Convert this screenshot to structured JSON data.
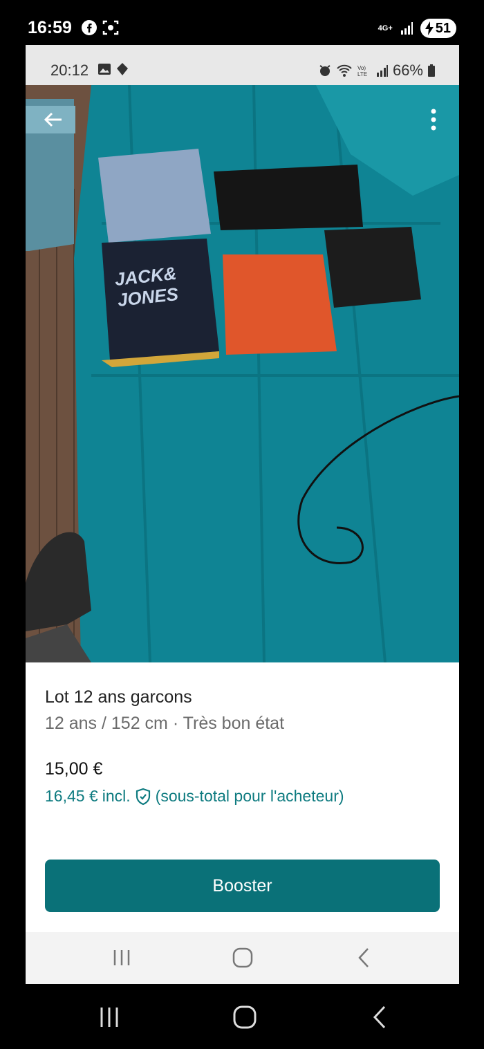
{
  "outer_status": {
    "time": "16:59",
    "network": "4G+",
    "battery": "51",
    "icons": [
      "facebook-icon",
      "screen-record-icon",
      "signal-icon",
      "charging-icon"
    ]
  },
  "inner_status": {
    "time": "20:12",
    "battery_percent": "66%",
    "icons": [
      "gallery-icon",
      "app-notification-icon",
      "alarm-icon",
      "wifi-icon",
      "volte-icon",
      "signal-icon",
      "battery-icon"
    ]
  },
  "photo": {
    "description_label": "JACK& JONES",
    "back_icon": "back-arrow-icon",
    "more_icon": "more-vertical-icon"
  },
  "listing": {
    "title": "Lot 12 ans garcons",
    "subtitle": "12 ans / 152 cm · Très bon état",
    "price": "15,00 €",
    "buyer_price": "16,45 €",
    "buyer_incl": "incl.",
    "buyer_note": "(sous-total pour l'acheteur)",
    "booster_label": "Booster"
  },
  "colors": {
    "accent": "#0a7178",
    "buyer_price": "#0e7b80",
    "bedsheet": "#0e7f8e"
  },
  "nav": {
    "icons": [
      "recent-apps-icon",
      "home-icon",
      "back-icon"
    ]
  }
}
